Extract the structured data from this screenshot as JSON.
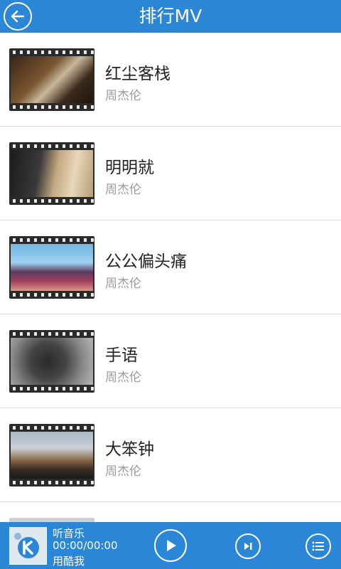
{
  "header": {
    "title": "排行MV",
    "back_icon": "back-arrow-icon"
  },
  "colors": {
    "accent": "#2b86d6",
    "title_text": "#ffffff",
    "song_text": "#222222",
    "artist_text": "#9a9a9a"
  },
  "mv_list": [
    {
      "song": "红尘客栈",
      "artist": "周杰伦"
    },
    {
      "song": "明明就",
      "artist": "周杰伦"
    },
    {
      "song": "公公偏头痛",
      "artist": "周杰伦"
    },
    {
      "song": "手语",
      "artist": "周杰伦"
    },
    {
      "song": "大笨钟",
      "artist": "周杰伦"
    }
  ],
  "player": {
    "title": "听音乐",
    "time": "00:00/00:00",
    "subtitle": "用酷我",
    "play_icon": "play-icon",
    "next_icon": "next-track-icon",
    "playlist_icon": "playlist-icon"
  }
}
